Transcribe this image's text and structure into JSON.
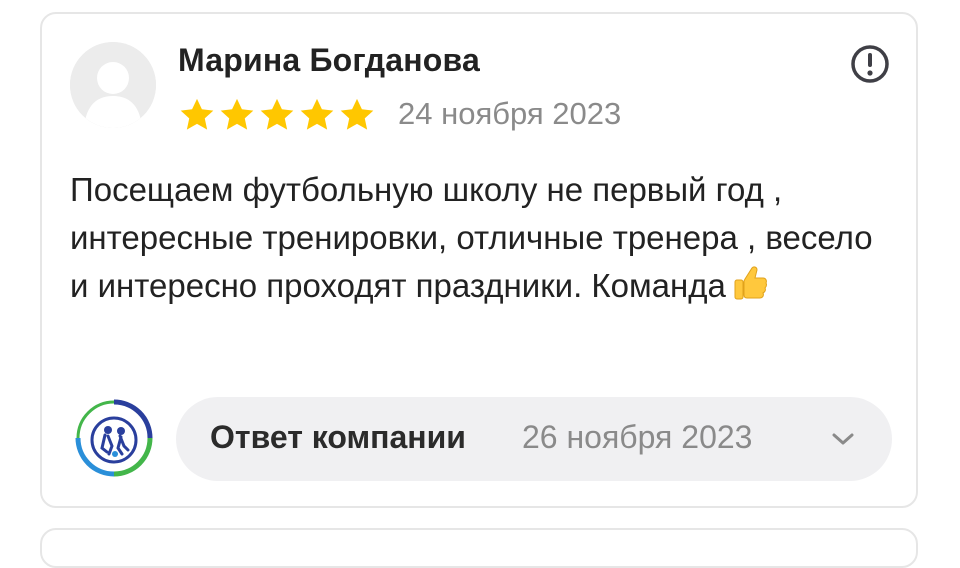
{
  "review": {
    "author": "Марина Богданова",
    "rating": 5,
    "rating_max": 5,
    "date": "24 ноября 2023",
    "text": "Посещаем футбольную школу не первый год , интересные тренировки, отличные тренера , весело и интересно проходят праздники. Команда",
    "text_emoji": "thumbs-up-icon",
    "report_icon": "exclamation-circle-icon",
    "avatar_icon": "user-silhouette-icon"
  },
  "company_reply": {
    "label": "Ответ компании",
    "date": "26 ноября 2023",
    "toggle_icon": "chevron-down-icon",
    "logo_icon": "company-logo-icon"
  },
  "colors": {
    "star": "#ffc700",
    "muted_text": "#8a8a8a",
    "reply_bg": "#f0f0f2",
    "border": "#e6e6e6",
    "logo_blue": "#2a3f9d",
    "logo_green": "#43b64a"
  }
}
